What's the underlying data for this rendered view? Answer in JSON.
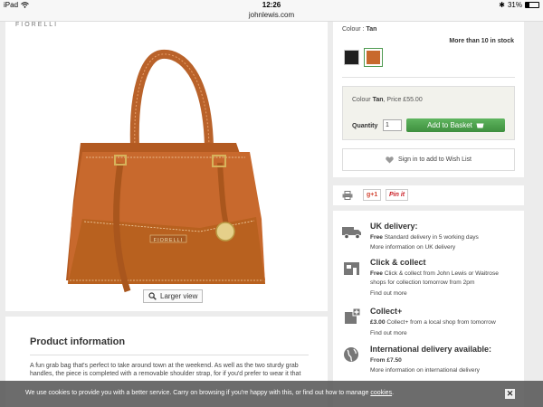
{
  "status_bar": {
    "device": "iPad",
    "time": "12:26",
    "battery": "31%",
    "url": "johnlewis.com"
  },
  "product": {
    "brand_mark": "FIORELLI",
    "bag_brand_plate": "FIORELLI",
    "larger_view_label": "Larger view",
    "colour_label": "Colour :",
    "colour_value": "Tan",
    "stock_text": "More than 10 in stock",
    "swatches": [
      "Black",
      "Tan"
    ],
    "price_prefix": "Colour",
    "price_colour": "Tan",
    "price_text": ", Price £55.00",
    "quantity_label": "Quantity",
    "quantity_value": "1",
    "add_to_basket_label": "Add to Basket",
    "wishlist_label": "Sign in to add to Wish List",
    "colors": {
      "tan": "#c8692d",
      "black": "#1f1f1f",
      "basket_green": "#4a9f4a"
    }
  },
  "share": {
    "gplus_label": "g+1",
    "pinit_label": "Pin it"
  },
  "delivery": {
    "uk_title": "UK delivery:",
    "uk_free": "Free",
    "uk_line1": " Standard delivery in 5 working days",
    "uk_line2": "More information on UK delivery",
    "cc_title": "Click & collect",
    "cc_free": "Free",
    "cc_line1": " Click & collect from John Lewis or Waitrose",
    "cc_line2": "shops for collection tomorrow from 2pm",
    "cc_line3": "Find out more",
    "cplus_title": "Collect+",
    "cplus_price": "£3.00",
    "cplus_line1": " Collect+ from a local shop from tomorrow",
    "cplus_line2": "Find out more",
    "intl_title": "International delivery available:",
    "intl_price": "From £7.50",
    "intl_line1": "More information on international delivery"
  },
  "info": {
    "title": "Product information",
    "text": "A fun grab bag that's perfect to take around town at the weekend. As well as the two sturdy grab handles, the piece is completed with a removable shoulder strap, for if you'd prefer to wear it that"
  },
  "cookie": {
    "text": "We use cookies to provide you with a better service. Carry on browsing if you're happy with this, or find out how to manage ",
    "link": "cookies",
    "close": "✕"
  }
}
